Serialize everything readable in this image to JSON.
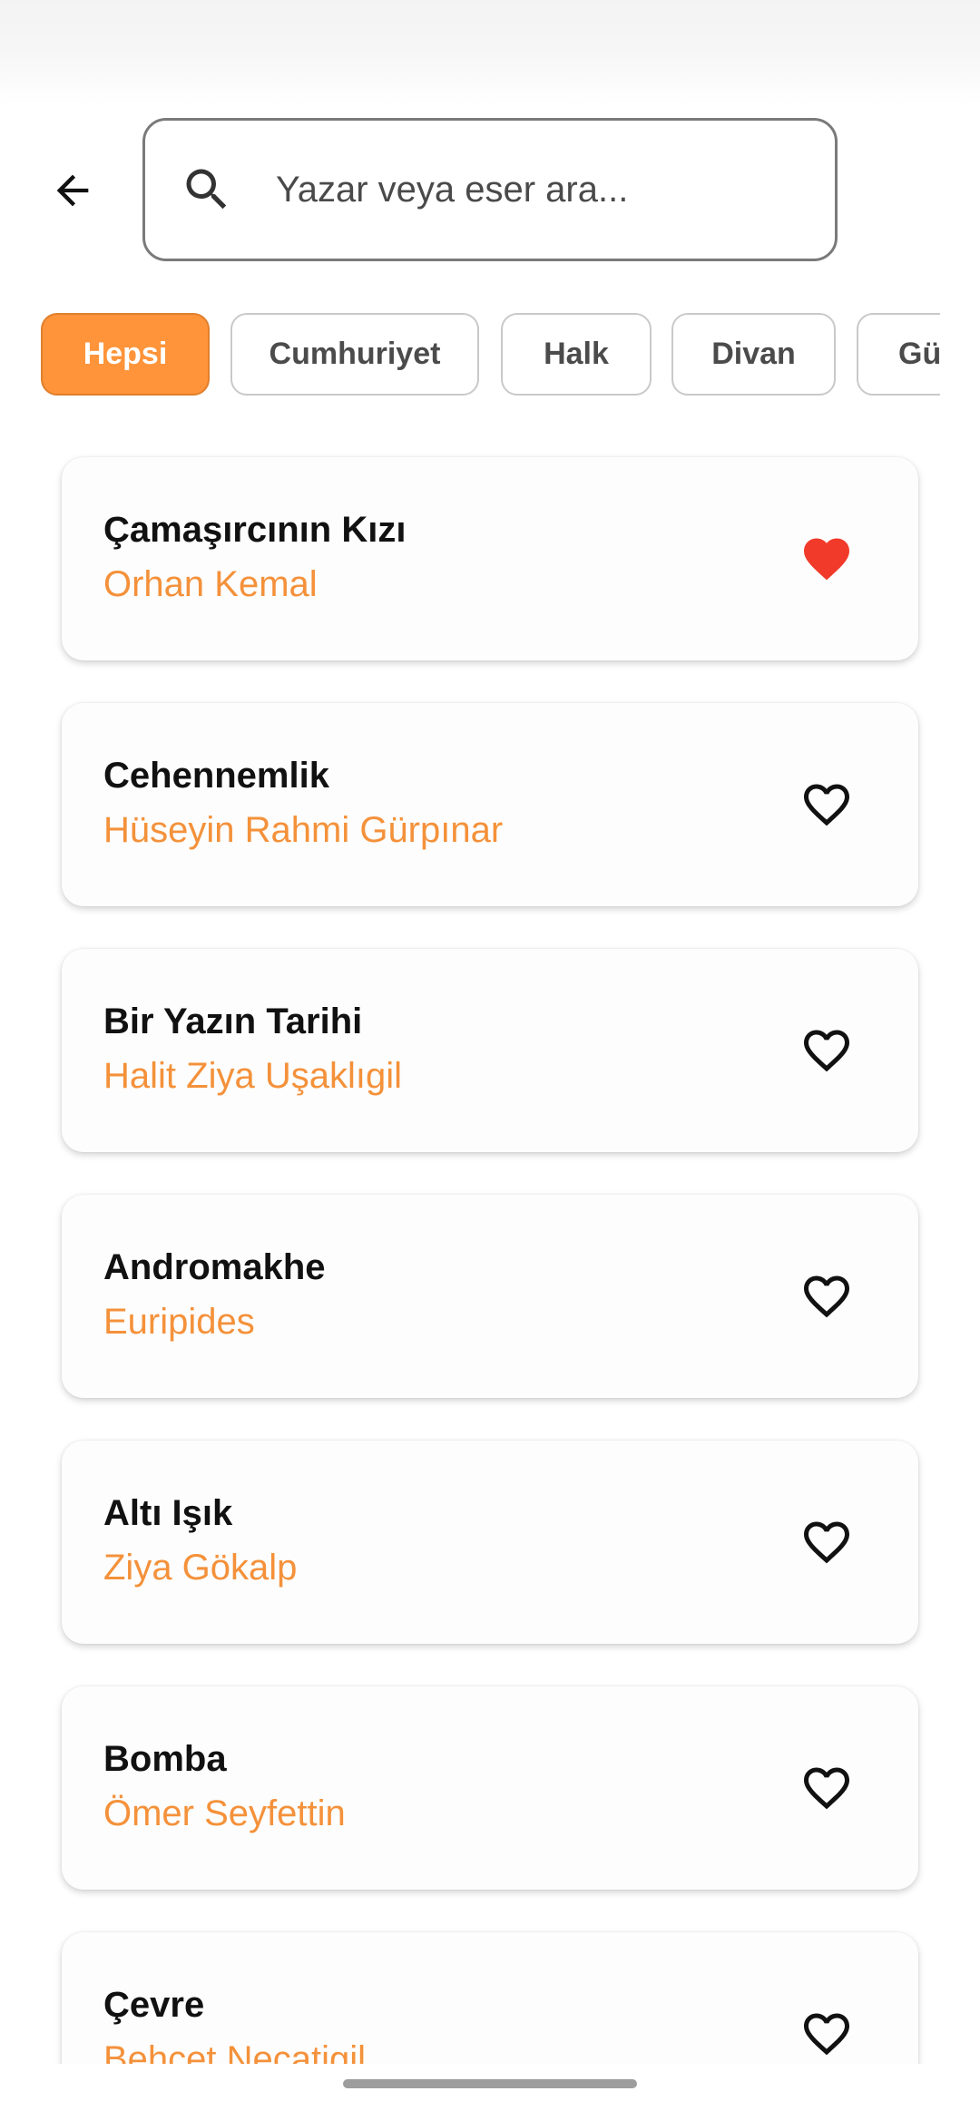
{
  "search": {
    "placeholder": "Yazar veya eser ara..."
  },
  "categories": [
    {
      "label": "Hepsi",
      "active": true
    },
    {
      "label": "Cumhuriyet",
      "active": false
    },
    {
      "label": "Halk",
      "active": false
    },
    {
      "label": "Divan",
      "active": false
    },
    {
      "label": "Gü",
      "active": false
    }
  ],
  "works": [
    {
      "title": "Çamaşırcının Kızı",
      "author": "Orhan Kemal",
      "favorite": true
    },
    {
      "title": "Cehennemlik",
      "author": "Hüseyin Rahmi Gürpınar",
      "favorite": false
    },
    {
      "title": "Bir Yazın Tarihi",
      "author": "Halit Ziya Uşaklıgil",
      "favorite": false
    },
    {
      "title": "Andromakhe",
      "author": "Euripides",
      "favorite": false
    },
    {
      "title": "Altı Işık",
      "author": "Ziya Gökalp",
      "favorite": false
    },
    {
      "title": "Bomba",
      "author": "Ömer Seyfettin",
      "favorite": false
    },
    {
      "title": "Çevre",
      "author": "Behçet Necatigil",
      "favorite": false
    }
  ],
  "icons": {
    "back": "arrow-left-icon",
    "search": "search-icon",
    "favorite_on": "heart-filled-icon",
    "favorite_off": "heart-outline-icon"
  },
  "colors": {
    "accent": "#ff943a",
    "author_text": "#f4913a",
    "favorite": "#f23a2a"
  }
}
